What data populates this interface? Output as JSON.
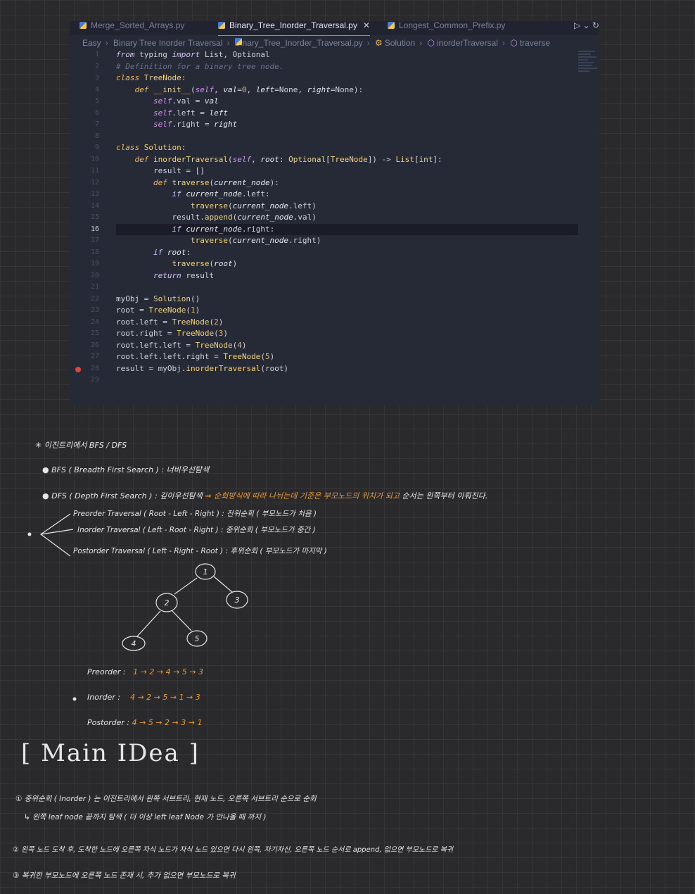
{
  "editor": {
    "tabs": [
      {
        "label": "Merge_Sorted_Arrays.py",
        "active": false
      },
      {
        "label": "Binary_Tree_Inorder_Traversal.py",
        "active": true
      },
      {
        "label": "Longest_Common_Prefix.py",
        "active": false
      }
    ],
    "tab_tools": "▷ ⌄  ↻",
    "breadcrumb": [
      "Easy",
      "Binary Tree Inorder Traversal",
      "Binary_Tree_Inorder_Traversal.py",
      "Solution",
      "inorderTraversal",
      "traverse"
    ],
    "current_line": 16,
    "breakpoint_line": 28,
    "lines": [
      "1",
      "2",
      "3",
      "4",
      "5",
      "6",
      "7",
      "8",
      "9",
      "10",
      "11",
      "12",
      "13",
      "14",
      "15",
      "16",
      "17",
      "18",
      "19",
      "20",
      "21",
      "22",
      "23",
      "24",
      "25",
      "26",
      "27",
      "28",
      "29"
    ]
  },
  "notes": {
    "heading": "✳ 이진트리에서 BFS / DFS",
    "bfs": "BFS ( Breadth First Search ) : 너비우선탐색",
    "dfs_prefix": "DFS ( Depth First Search ) : 깊이우선탐색",
    "dfs_arrow": "⇒",
    "dfs_note_orange": "순회방식에 따라 나뉘는데 기준은 부모노드의 위치가 되고",
    "dfs_note_rest": "순서는 왼쪽부터 이뤄진다.",
    "preorder_def": "Preorder Traversal ( Root - Left - Right ) : 전위순회 ( 부모노드가 처음 )",
    "inorder_def": "Inorder Traversal ( Left - Root - Right ) : 중위순회 ( 부모노드가 중간 )",
    "postorder_def": "Postorder Traversal ( Left - Right - Root ) : 후위순회 ( 부모노드가 마지막 )",
    "tree_nodes": [
      "1",
      "2",
      "3",
      "4",
      "5"
    ],
    "preorder_label": "Preorder :",
    "preorder_seq": "1 → 2 → 4 → 5 → 3",
    "inorder_label": "Inorder :",
    "inorder_seq": "4 → 2 → 5 → 1 → 3",
    "postorder_label": "Postorder :",
    "postorder_seq": "4 → 5 → 2 → 3 → 1",
    "main_idea": "[ Main IDea ]",
    "idea1": "① 중위순회 ( Inorder ) 는 이진트리에서 왼쪽 서브트리, 현재 노드, 오른쪽 서브트리 순으로 순회",
    "idea1b": "↳ 왼쪽 leaf node 끝까지 탐색 ( 더 이상 left leaf Node 가 안나올 때 까지 )",
    "idea2": "② 왼쪽 노드 도착 후, 도착한 노드에 오른쪽 자식 노드가 자식 노드 있으면 다시 왼쪽, 자기자신, 오른쪽 노드 순서로 append, 없으면 부모노드로 복귀",
    "idea3": "③ 복귀한 부모노드에 오른쪽 노드 존재 시, 추가 없으면 부모노드로 복귀"
  },
  "colors": {
    "orange": "#e59a3a",
    "editor_bg": "#262a37",
    "breakpoint": "#e0443e"
  }
}
